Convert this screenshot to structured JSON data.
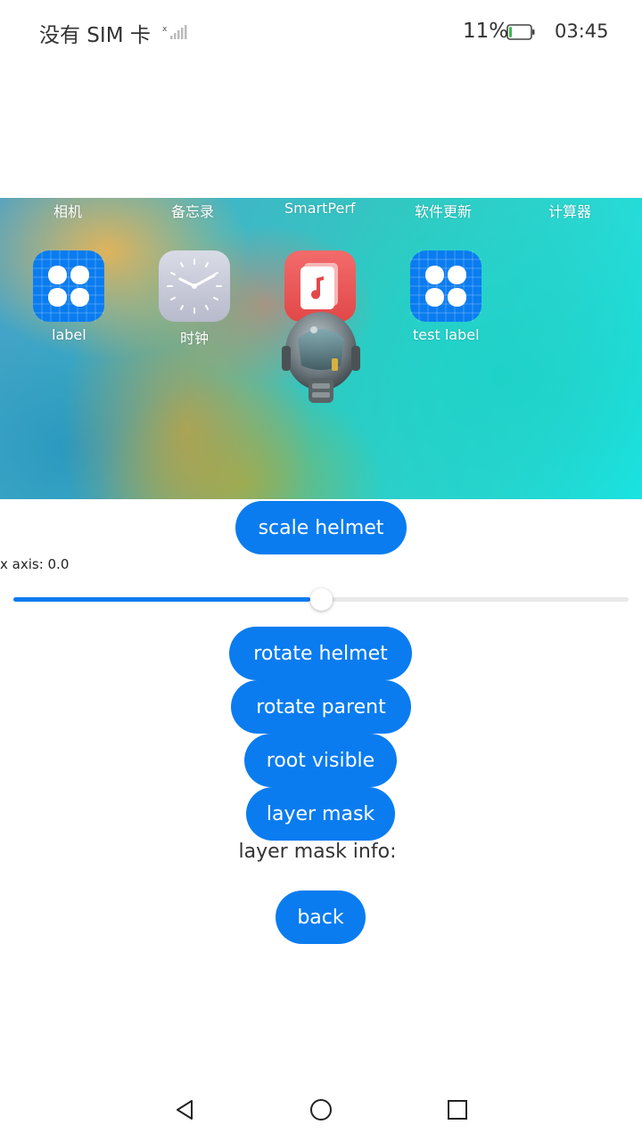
{
  "status_bar": {
    "carrier": "没有 SIM 卡",
    "battery_percent": "11%",
    "battery_level": 0.11,
    "time": "03:45"
  },
  "scene": {
    "top_labels": [
      "相机",
      "备忘录",
      "SmartPerf",
      "软件更新",
      "计算器"
    ],
    "icons": [
      {
        "icon": "app-grid-icon",
        "label": "label"
      },
      {
        "icon": "clock-icon",
        "label": "时钟"
      },
      {
        "icon": "music-icon",
        "label": ""
      },
      {
        "icon": "app-grid-icon",
        "label": "test label"
      }
    ],
    "model": "helmet-model"
  },
  "controls": {
    "scale_helmet": "scale helmet",
    "x_axis_label": "x axis: 0.0",
    "slider_value": 0.5,
    "rotate_helmet": "rotate helmet",
    "rotate_parent": "rotate parent",
    "root_visible": "root visible",
    "layer_mask": "layer mask",
    "layer_mask_info": "layer mask info:",
    "back": "back"
  },
  "colors": {
    "accent": "#0a7cf0",
    "battery_low": "#3fb950"
  }
}
